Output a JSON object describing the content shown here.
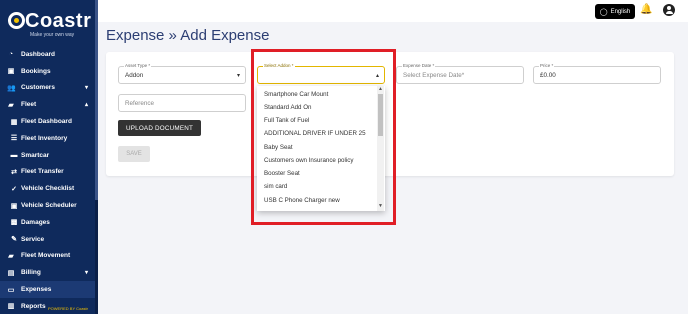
{
  "brand": {
    "name": "Coastr",
    "tagline": "Make your own way",
    "powered_by": "POWERED BY Coastr"
  },
  "sidebar": {
    "items": [
      {
        "label": "Dashboard",
        "icon": "gauge-icon"
      },
      {
        "label": "Bookings",
        "icon": "calendar-icon"
      },
      {
        "label": "Customers",
        "icon": "users-icon",
        "chevron": "⌄"
      },
      {
        "label": "Fleet",
        "icon": "car-icon",
        "chevron": "⌃"
      },
      {
        "label": "Fleet Dashboard",
        "icon": "grid-icon"
      },
      {
        "label": "Fleet Inventory",
        "icon": "list-icon"
      },
      {
        "label": "Smartcar",
        "icon": "car-icon"
      },
      {
        "label": "Fleet Transfer",
        "icon": "transfer-icon"
      },
      {
        "label": "Vehicle Checklist",
        "icon": "check-icon"
      },
      {
        "label": "Vehicle Scheduler",
        "icon": "calendar-icon"
      },
      {
        "label": "Damages",
        "icon": "warning-icon"
      },
      {
        "label": "Service",
        "icon": "wrench-icon"
      },
      {
        "label": "Fleet Movement",
        "icon": "truck-icon"
      },
      {
        "label": "Billing",
        "icon": "bill-icon",
        "chevron": "⌄"
      },
      {
        "label": "Expenses",
        "icon": "money-icon"
      },
      {
        "label": "Reports",
        "icon": "chart-icon"
      }
    ]
  },
  "topbar": {
    "language": "English"
  },
  "page": {
    "title": "Expense » Add Expense"
  },
  "form": {
    "asset_type": {
      "label": "Asset Type *",
      "value": "Addon"
    },
    "select_addon": {
      "label": "Select Addon *",
      "value": ""
    },
    "expense_date": {
      "label": "Expense Date *",
      "placeholder": "Select Expense Date*"
    },
    "price": {
      "label": "Price *",
      "value": "£0.00"
    },
    "reference": {
      "placeholder": "Reference"
    },
    "upload_button": "UPLOAD DOCUMENT",
    "save_button": "SAVE"
  },
  "addon_options": [
    "Smartphone Car Mount",
    "Standard Add On",
    "Full Tank of Fuel",
    "ADDITIONAL DRIVER IF UNDER 25",
    "Baby Seat",
    "Customers own Insurance policy",
    "Booster Seat",
    "sim card",
    "USB C Phone Charger new"
  ],
  "colors": {
    "sidebar_bg": "#0f2a5c",
    "title": "#2c3e73",
    "highlight": "#e01e26",
    "focus": "#e3b600"
  }
}
